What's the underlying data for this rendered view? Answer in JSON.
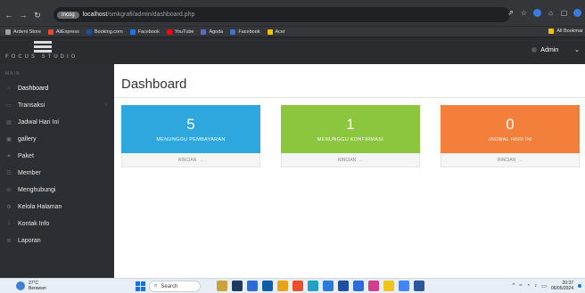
{
  "browser": {
    "pill": "Incóg",
    "url_host": "localhost",
    "url_path": "/smkgrafi/admin/dashboard.php",
    "bookmarks": [
      {
        "label": "Ardent Store",
        "color": "#9aa0a6"
      },
      {
        "label": "AliExpress",
        "color": "#e8482e"
      },
      {
        "label": "Booking.com",
        "color": "#1c4fa1"
      },
      {
        "label": "Facebook",
        "color": "#1877f2"
      },
      {
        "label": "YouTube",
        "color": "#ff0000"
      },
      {
        "label": "Agoda",
        "color": "#5c6bc0"
      },
      {
        "label": "Facebook",
        "color": "#3f6fd1"
      },
      {
        "label": "Acer",
        "color": "#f2c200"
      }
    ],
    "all_bookmarks": "All Bookmar"
  },
  "app": {
    "logo_text": "FOCUS STUDIO",
    "admin_label": "Admin"
  },
  "sidebar": {
    "title": "MAIN",
    "items": [
      {
        "label": "Dashboard",
        "icon": "home-icon",
        "glyph": "⌂"
      },
      {
        "label": "Transaksi",
        "icon": "cart-icon",
        "glyph": "▭",
        "caret": "‹"
      },
      {
        "label": "Jadwal Hari Ini",
        "icon": "calendar-icon",
        "glyph": "▤"
      },
      {
        "label": "gallery",
        "icon": "image-icon",
        "glyph": "▣"
      },
      {
        "label": "Paket",
        "icon": "gift-icon",
        "glyph": "✦"
      },
      {
        "label": "Member",
        "icon": "users-icon",
        "glyph": "☷"
      },
      {
        "label": "Menghubungi",
        "icon": "phone-icon",
        "glyph": "☏"
      },
      {
        "label": "Kelola Halaman",
        "icon": "gear-icon",
        "glyph": "⚙"
      },
      {
        "label": "Kontak Info",
        "icon": "info-icon",
        "glyph": "i"
      },
      {
        "label": "Laporan",
        "icon": "report-icon",
        "glyph": "≣"
      }
    ]
  },
  "main": {
    "title": "Dashboard",
    "cards": [
      {
        "count": "5",
        "label": "MENUNGGU PEMBAYARAN",
        "footer": "RINCIAN",
        "color": "#2ea7de"
      },
      {
        "count": "1",
        "label": "MENUNGGU KONFIRMASI",
        "footer": "RINCIAN",
        "color": "#8cc63e"
      },
      {
        "count": "0",
        "label": "JADWAL HARI INI",
        "footer": "RINCIAN",
        "color": "#f47f3a"
      }
    ]
  },
  "taskbar": {
    "weather_temp": "27°C",
    "weather_desc": "Berawan",
    "search": "Search",
    "time": "20:37",
    "date": "06/05/2024"
  }
}
